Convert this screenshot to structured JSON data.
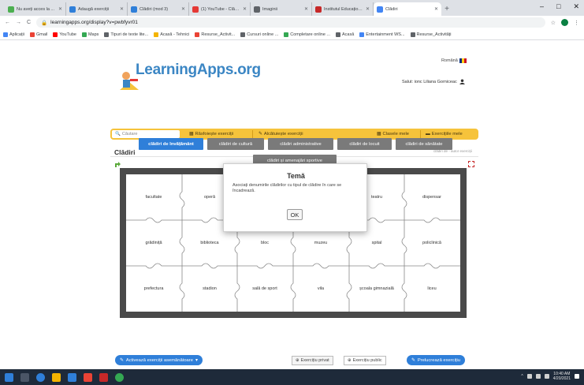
{
  "browser": {
    "tabs": [
      {
        "label": "Nu aveți acces la ...",
        "color": "#4caf50",
        "active": false
      },
      {
        "label": "Adaugă exerciții",
        "color": "#2f7fd9",
        "active": false
      },
      {
        "label": "Clădiri (mod 3)",
        "color": "#2f7fd9",
        "active": false
      },
      {
        "label": "(1) YouTube - Clădiri",
        "color": "#e53935",
        "active": false
      },
      {
        "label": "Imaginii",
        "color": "#5f6368",
        "active": false
      },
      {
        "label": "Institutul Educațional",
        "color": "#c62828",
        "active": false
      },
      {
        "label": "Clădiri",
        "color": "#4285f4",
        "active": true
      }
    ],
    "new_tab_label": "+",
    "win_controls": [
      "–",
      "□",
      "✕"
    ],
    "url": "learningapps.org/display?v=pwbfyvr01",
    "bookmarks": [
      {
        "label": "Aplicații",
        "color": "#4285f4"
      },
      {
        "label": "Gmail",
        "color": "#ea4335"
      },
      {
        "label": "YouTube",
        "color": "#ff0000"
      },
      {
        "label": "Maps",
        "color": "#34a853"
      },
      {
        "label": "Tipuri de texte lite...",
        "color": "#5f6368"
      },
      {
        "label": "Acasă - Tehnici",
        "color": "#f4b400"
      },
      {
        "label": "Resurse_Activit...",
        "color": "#ea4335"
      },
      {
        "label": "Cursuri online ...",
        "color": "#5f6368"
      },
      {
        "label": "Completare online ...",
        "color": "#34a853"
      },
      {
        "label": "Acasă",
        "color": "#5f6368"
      },
      {
        "label": "Entertainment WS...",
        "color": "#4285f4"
      },
      {
        "label": "Resurse_Activități",
        "color": "#5f6368"
      }
    ]
  },
  "page": {
    "language": "Română",
    "logo_text": "LearningApps.org",
    "user_label": "Salut: ionc Liliana Gorniceac",
    "search_placeholder": "Căutare",
    "nav": [
      {
        "label": "Răsfoiește exerciții",
        "icon": "grid-icon"
      },
      {
        "label": "Alcătuiește exerciții",
        "icon": "pencil-icon"
      },
      {
        "label": "Clasele mele",
        "icon": "grid-icon"
      },
      {
        "label": "Exercițiile mele",
        "icon": "folder-icon"
      }
    ],
    "title": "Clădiri",
    "author": "clădiri de - autor exerciții",
    "categories": [
      {
        "label": "clădiri de învățământ",
        "active": true
      },
      {
        "label": "clădiri de cultură",
        "active": false
      },
      {
        "label": "clădiri administrative",
        "active": false
      },
      {
        "label": "clădiri de locuit",
        "active": false
      },
      {
        "label": "clădiri de sănătate",
        "active": false
      },
      {
        "label": "clădiri și amenajări sportive",
        "active": false
      }
    ],
    "pieces": [
      [
        "facultate",
        "operă",
        "",
        "",
        "teatru",
        "dispensar"
      ],
      [
        "grădiniță",
        "biblioteca",
        "bloc",
        "muzeu",
        "spital",
        "policlinică"
      ],
      [
        "prefectura",
        "stadion",
        "sală de sport",
        "vila",
        "școala gimnazială",
        "liceu"
      ]
    ],
    "modal": {
      "title": "Temă",
      "body": "Asociați denumirile clădirilor cu tipul de clădire în care se încadrează.",
      "ok_label": "OK"
    },
    "footer": {
      "activate_label": "Activează exerciții asemănătoare",
      "private_label": "Exercițiu privat",
      "public_label": "Exercițiu public",
      "edit_label": "Prelucrează exercițiu"
    }
  },
  "taskbar": {
    "icons": [
      "#2f7fd9",
      "#f4b400",
      "#2f7fd9",
      "#34a853",
      "#ea4335",
      "#c62828",
      "#2f7fd9"
    ],
    "time": "10:40 AM",
    "date": "4/20/2021"
  },
  "colors": {
    "accent_yellow": "#f6c33b",
    "primary_blue": "#2f7fd9",
    "board_dark": "#4a4a4a"
  }
}
